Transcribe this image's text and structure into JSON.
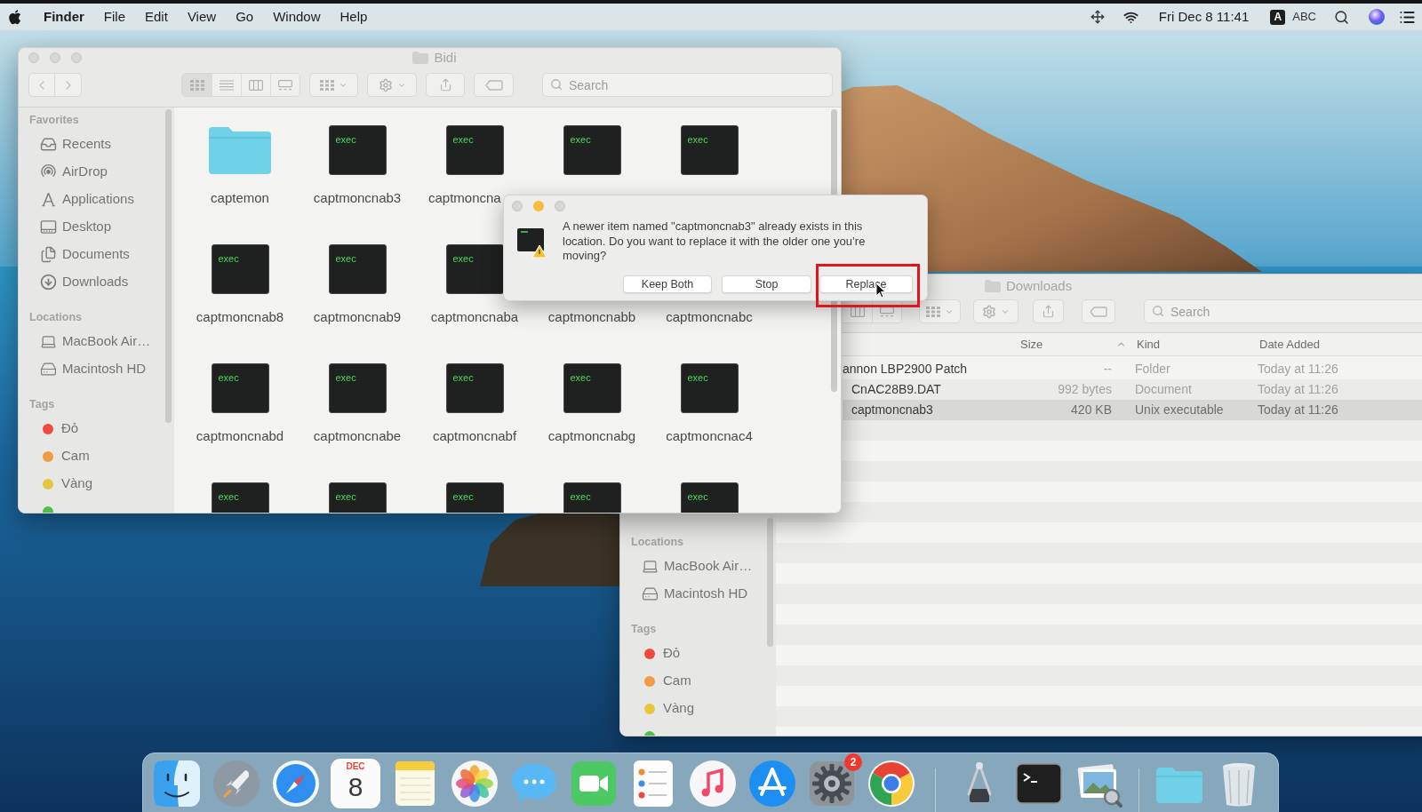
{
  "menu_bar": {
    "app_menu": "Finder",
    "menus": [
      "File",
      "Edit",
      "View",
      "Go",
      "Window",
      "Help"
    ],
    "clock": "Fri Dec 8 11:41",
    "input_source": {
      "badge": "A",
      "label": "ABC"
    }
  },
  "finder_window": {
    "title": "Bidi",
    "window_buttons": [
      {
        "enabled": false
      },
      {
        "enabled": false
      },
      {
        "enabled": false
      }
    ],
    "view_buttons": [
      {
        "kind": "icons",
        "selected": true
      },
      {
        "kind": "list",
        "selected": false
      },
      {
        "kind": "columns",
        "selected": false
      },
      {
        "kind": "gallery",
        "selected": false
      }
    ],
    "search": {
      "placeholder": "Search"
    },
    "sidebar": [
      {
        "heading": "Favorites",
        "items": [
          {
            "kind": "recents",
            "label": "Recents"
          },
          {
            "kind": "airdrop",
            "label": "AirDrop"
          },
          {
            "kind": "applications",
            "label": "Applications"
          },
          {
            "kind": "desktop",
            "label": "Desktop"
          },
          {
            "kind": "documents",
            "label": "Documents"
          },
          {
            "kind": "downloads",
            "label": "Downloads"
          }
        ]
      },
      {
        "heading": "Locations",
        "items": [
          {
            "kind": "laptop",
            "label": "MacBook Air…"
          },
          {
            "kind": "disk",
            "label": "Macintosh HD"
          }
        ]
      },
      {
        "heading": "Tags",
        "items": [
          {
            "kind": "tag",
            "label": "Đỏ",
            "color": "#f04a3e"
          },
          {
            "kind": "tag",
            "label": "Cam",
            "color": "#f29a45"
          },
          {
            "kind": "tag",
            "label": "Vàng",
            "color": "#e8c63c"
          },
          {
            "kind": "tag",
            "color": "#4fc04a"
          }
        ]
      }
    ],
    "files": [
      {
        "name": "captemon",
        "icon": {
          "kind": "folder"
        }
      },
      {
        "name": "captmoncnab3",
        "icon": {
          "kind": "executable",
          "label": "exec"
        }
      },
      {
        "name": "captmoncna",
        "icon": {
          "kind": "executable",
          "label": "exec"
        }
      },
      {
        "icon": {
          "kind": "executable",
          "label": "exec"
        }
      },
      {
        "icon": {
          "kind": "executable",
          "label": "exec"
        }
      },
      {
        "name": "captmoncnab8",
        "icon": {
          "kind": "executable",
          "label": "exec"
        }
      },
      {
        "name": "captmoncnab9",
        "icon": {
          "kind": "executable",
          "label": "exec"
        }
      },
      {
        "name": "captmoncnaba",
        "icon": {
          "kind": "executable",
          "label": "exec"
        }
      },
      {
        "name": "captmoncnabb"
      },
      {
        "name": "captmoncnabc"
      },
      {
        "name": "captmoncnabd",
        "icon": {
          "kind": "executable",
          "label": "exec"
        }
      },
      {
        "name": "captmoncnabe",
        "icon": {
          "kind": "executable",
          "label": "exec"
        }
      },
      {
        "name": "captmoncnabf",
        "icon": {
          "kind": "executable",
          "label": "exec"
        }
      },
      {
        "name": "captmoncnabg",
        "icon": {
          "kind": "executable",
          "label": "exec"
        }
      },
      {
        "name": "captmoncnac4",
        "icon": {
          "kind": "executable",
          "label": "exec"
        }
      },
      {
        "icon": {
          "kind": "executable",
          "label": "exec"
        }
      },
      {
        "icon": {
          "kind": "executable",
          "label": "exec"
        }
      },
      {
        "icon": {
          "kind": "executable",
          "label": "exec"
        }
      },
      {
        "icon": {
          "kind": "executable",
          "label": "exec"
        }
      },
      {
        "icon": {
          "kind": "executable",
          "label": "exec"
        }
      }
    ]
  },
  "alert": {
    "window_buttons": [
      {
        "enabled": false
      },
      {
        "enabled": true
      },
      {
        "enabled": false
      }
    ],
    "message": "A newer item named \"captmoncnab3\" already exists in this location. Do you want to replace it with the older one you’re moving?",
    "buttons": [
      {
        "label": "Keep Both",
        "highlighted": false
      },
      {
        "label": "Stop",
        "highlighted": false
      },
      {
        "label": "Replace",
        "highlighted": true
      }
    ]
  },
  "downloads_window": {
    "title": "Downloads",
    "view_buttons": [
      {
        "kind": "columns",
        "selected": false
      },
      {
        "kind": "gallery",
        "selected": false
      }
    ],
    "search": {
      "placeholder": "Search"
    },
    "sidebar": [
      {
        "heading": "Locations",
        "items": [
          {
            "kind": "laptop",
            "label": "MacBook Air…"
          },
          {
            "kind": "disk",
            "label": "Macintosh HD"
          }
        ]
      },
      {
        "heading": "Tags",
        "items": [
          {
            "kind": "tag",
            "label": "Đỏ",
            "color": "#f04a3e"
          },
          {
            "kind": "tag",
            "label": "Cam",
            "color": "#f29a45"
          },
          {
            "kind": "tag",
            "label": "Vàng",
            "color": "#e8c63c"
          },
          {
            "kind": "tag",
            "color": "#4fc04a"
          }
        ]
      }
    ],
    "columns": [
      {
        "label": "Size",
        "sorted": true
      },
      {
        "label": "Kind",
        "sorted": false
      },
      {
        "label": "Date Added",
        "sorted": false
      }
    ],
    "rows": [
      {
        "name": "annon LBP2900 Patch",
        "size": "--",
        "kind": "Folder",
        "date_added": "Today at 11:26",
        "selected": false,
        "children": [
          {
            "name": "CnAC28B9.DAT",
            "size": "992 bytes",
            "kind": "Document",
            "date_added": "Today at 11:26",
            "selected": false
          },
          {
            "name": "captmoncnab3",
            "size": "420 KB",
            "kind": "Unix executable",
            "date_added": "Today at 11:26",
            "selected": true
          }
        ]
      }
    ]
  },
  "dock": {
    "calendar": {
      "month": "DEC",
      "day": "8"
    },
    "settings_badge": "2"
  }
}
